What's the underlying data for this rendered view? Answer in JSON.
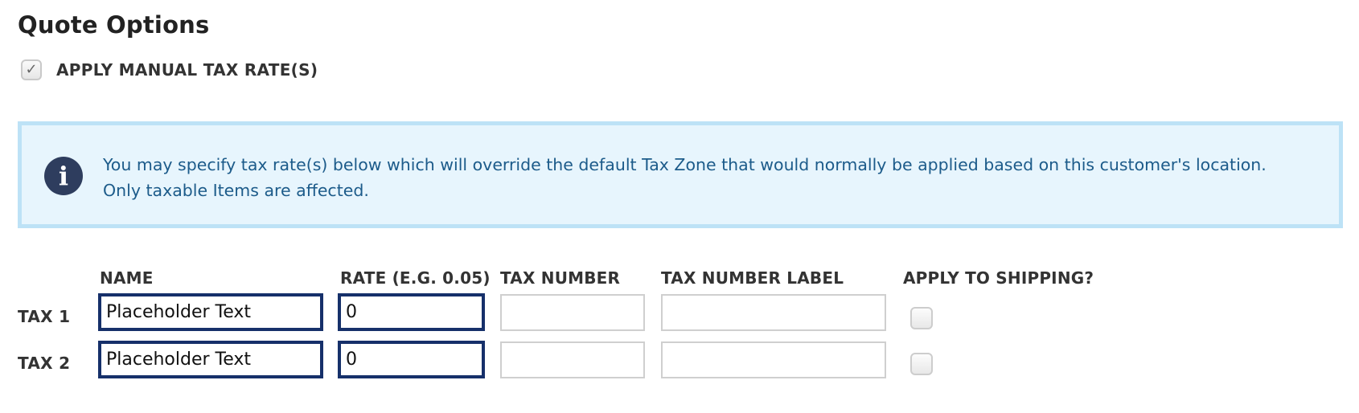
{
  "title": "Quote Options",
  "manual_tax": {
    "label": "APPLY MANUAL TAX RATE(S)",
    "checked": true,
    "check_glyph": "✓"
  },
  "info": {
    "icon": "i",
    "line1": "You may specify tax rate(s) below which will override the default Tax Zone that would normally be applied based on this customer's location.",
    "line2": "Only taxable Items are affected."
  },
  "table": {
    "headers": {
      "name": "NAME",
      "rate": "RATE (E.G. 0.05)",
      "tax_number": "TAX NUMBER",
      "tax_number_label": "TAX NUMBER LABEL",
      "apply_shipping": "APPLY TO SHIPPING?"
    },
    "rows": [
      {
        "label": "TAX 1",
        "name": "Placeholder Text",
        "rate": "0",
        "tax_number": "",
        "tax_number_label": "",
        "apply_shipping": false
      },
      {
        "label": "TAX 2",
        "name": "Placeholder Text",
        "rate": "0",
        "tax_number": "",
        "tax_number_label": "",
        "apply_shipping": false
      }
    ]
  },
  "colors": {
    "info_bg": "#e7f5fd",
    "info_border": "#bde2f6",
    "info_text": "#1c5b8a",
    "focus_border": "#16306a"
  }
}
